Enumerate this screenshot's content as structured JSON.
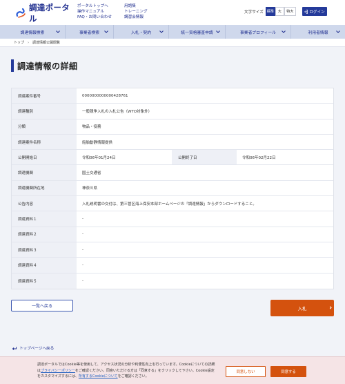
{
  "header": {
    "logo_text": "調達ポータル",
    "links_col1": [
      "ポータルトップへ",
      "操作マニュアル",
      "FAQ・お問い合わせ"
    ],
    "links_col2": [
      "用語集",
      "トレーニング",
      "講習会情報"
    ],
    "font_size_label": "文字サイズ",
    "font_sizes": [
      "標準",
      "大",
      "特大"
    ],
    "login_label": "ログイン"
  },
  "nav": {
    "items": [
      "調達情報検索",
      "事業者検索",
      "入札・契約",
      "統一資格審査申請",
      "事業者プロフィール",
      "利用者情報"
    ]
  },
  "breadcrumb": {
    "home": "トップ",
    "current": "調達情報公開閲覧"
  },
  "page": {
    "title": "調達情報の詳細"
  },
  "details": {
    "case_no_label": "調達案件番号",
    "case_no": "0000000000000428761",
    "type_label": "調達種別",
    "type": "一般競争入札の入札公告（WTO対象外）",
    "category_label": "分類",
    "category": "物品・役務",
    "name_label": "調達案件名称",
    "name": "船舶動静情報提供",
    "start_label": "公開開始日",
    "start": "令和06年01月24日",
    "end_label": "公開終了日",
    "end": "令和06年02月22日",
    "org_label": "調達機関",
    "org": "国土交通省",
    "location_label": "調達機関所在地",
    "location": "神奈川県",
    "notice_label": "公告内容",
    "notice": "入札説明書の交付は、第三管区海上保安本部ホームページの「調達情報」からダウンロードすること。",
    "docs": [
      {
        "label": "調達資料１",
        "value": "-"
      },
      {
        "label": "調達資料２",
        "value": "-"
      },
      {
        "label": "調達資料３",
        "value": "-"
      },
      {
        "label": "調達資料４",
        "value": "-"
      },
      {
        "label": "調達資料５",
        "value": "-"
      }
    ]
  },
  "actions": {
    "back_label": "一覧へ戻る",
    "bid_label": "入札"
  },
  "footer": {
    "top_link": "トップページへ戻る"
  },
  "cookie": {
    "text_before": "調達ポータルではCookie等を使用して、アクセス状況の分析や利便性向上を行っています。Cookieについての詳細は",
    "privacy_link": "プライバシーポリシー",
    "text_middle": "をご確認ください。同意いただける方は「同意する」をクリックして下さい。Cookie設定をカスタマイズするには、",
    "settings_link": "所有するCookieについて",
    "text_after": "をご確認ください。",
    "decline_label": "同意しない",
    "agree_label": "同意する"
  },
  "colors": {
    "brand": "#243a9a",
    "accent": "#d4520e",
    "nav_bg": "#cfd8ec",
    "page_bg": "#f1f3f8"
  }
}
